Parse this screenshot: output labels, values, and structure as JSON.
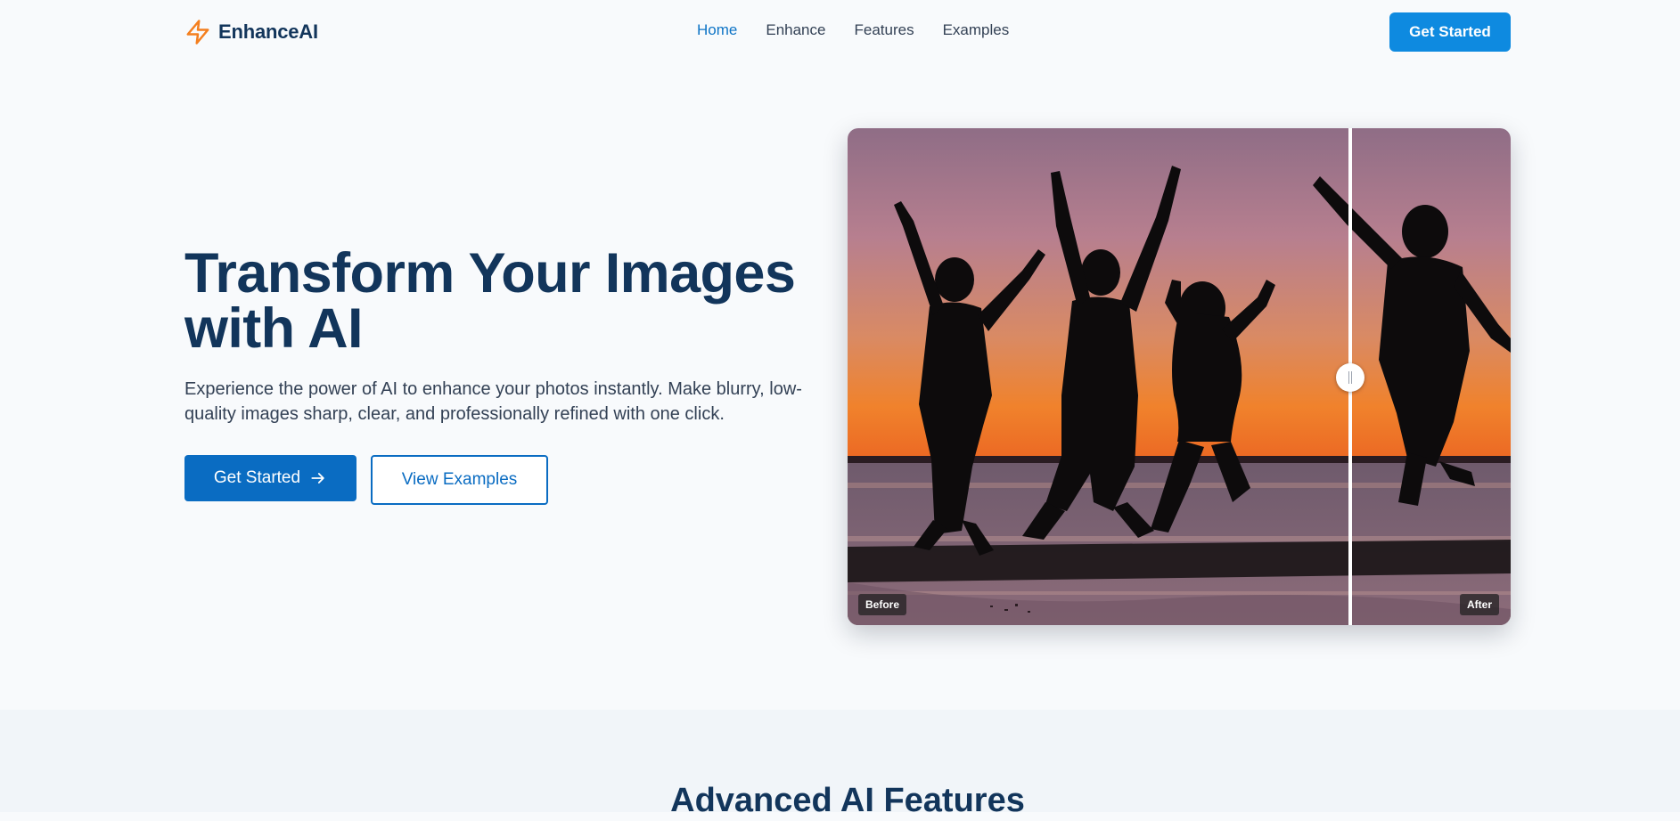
{
  "header": {
    "brand": "EnhanceAI",
    "nav": [
      "Home",
      "Enhance",
      "Features",
      "Examples"
    ],
    "active_nav": "Home",
    "cta_label": "Get Started"
  },
  "hero": {
    "title": "Transform Your Images with AI",
    "subtitle": "Experience the power of AI to enhance your photos instantly. Make blurry, low-quality images sharp, clear, and professionally refined with one click.",
    "primary_label": "Get Started",
    "secondary_label": "View Examples"
  },
  "compare": {
    "before_label": "Before",
    "after_label": "After",
    "split_fraction": 0.76
  },
  "features": {
    "title": "Advanced AI Features"
  },
  "icons": {
    "brand": "lightning-bolt-icon",
    "primary_button": "arrow-right-icon",
    "slider": "slider-handle-icon"
  },
  "colors": {
    "brand_accent": "#f47f1f",
    "primary": "#0a6cc2",
    "header_cta": "#0e8ae0",
    "heading": "#12355b",
    "nav_active": "#0e74c6",
    "background": "#f8fafc"
  }
}
